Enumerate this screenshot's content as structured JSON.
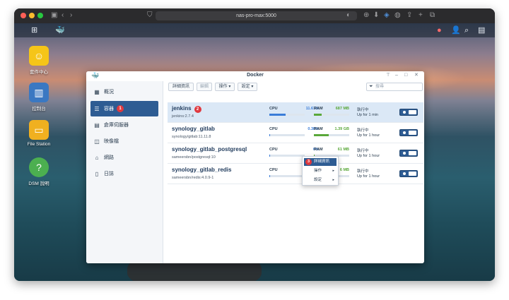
{
  "browser": {
    "url": "nas-pro-max:5000"
  },
  "desktop": {
    "icons": [
      {
        "label": "套件中心"
      },
      {
        "label": "控制台"
      },
      {
        "label": "File Station"
      },
      {
        "label": "DSM 說明"
      }
    ]
  },
  "window": {
    "title": "Docker",
    "sidebar": [
      {
        "label": "概況"
      },
      {
        "label": "容器",
        "badge": "1"
      },
      {
        "label": "倉庫伺服器"
      },
      {
        "label": "映像檔"
      },
      {
        "label": "網路"
      },
      {
        "label": "日誌"
      }
    ],
    "toolbar": {
      "details": "詳細資訊",
      "edit": "編輯",
      "action": "操作 ▾",
      "settings": "設定 ▾"
    },
    "search": {
      "placeholder": "搜尋"
    },
    "containers": [
      {
        "name": "jenkins",
        "image": "jenkins:2.7.4",
        "cpu": "11.61%",
        "cpu_fraction": 0.1161,
        "ram": "687 MB",
        "ram_fraction": 0.22,
        "status": "執行中",
        "uptime": "Up for 1 min",
        "badge": "2"
      },
      {
        "name": "synology_gitlab",
        "image": "synology/gitlab:11.11.8",
        "cpu": "0.38%",
        "cpu_fraction": 0.0038,
        "ram": "1.39 GB",
        "ram_fraction": 0.42,
        "status": "執行中",
        "uptime": "Up for 1 hour"
      },
      {
        "name": "synology_gitlab_postgresql",
        "image": "sameersbn/postgresql:10",
        "cpu": "0%",
        "cpu_fraction": 0.0,
        "ram": "61 MB",
        "ram_fraction": 0.02,
        "status": "執行中",
        "uptime": "Up for 1 hour"
      },
      {
        "name": "synology_gitlab_redis",
        "image": "sameersbn/redis:4.0.9-1",
        "cpu": "0.06%",
        "cpu_fraction": 0.0006,
        "ram": "6 MB",
        "ram_fraction": 0.005,
        "status": "執行中",
        "uptime": "Up for 1 hour"
      }
    ],
    "labels": {
      "cpu": "CPU",
      "ram": "RAM"
    },
    "context_menu": {
      "badge": "3",
      "items": [
        {
          "label": "詳細資訊"
        },
        {
          "label": "操作"
        },
        {
          "label": "設定"
        }
      ]
    }
  },
  "colors": {
    "accent": "#2e5c93",
    "cpu_bar": "#3b7dd8",
    "ram_bar": "#5aa83a",
    "badge": "#e0383e"
  }
}
